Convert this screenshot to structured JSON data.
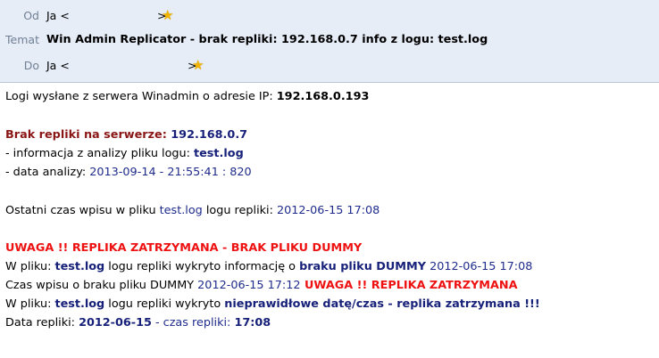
{
  "header": {
    "from_label": "Od",
    "from_value": "Ja <",
    "from_close": ">",
    "subject_label": "Temat",
    "subject_value": "Win Admin Replicator - brak repliki: 192.168.0.7 info z logu: test.log",
    "to_label": "Do",
    "to_value": "Ja <",
    "to_close": ">"
  },
  "message": {
    "l1_text": "Logi wysłane z serwera Winadmin o adresie IP: ",
    "l1_ip": "192.168.0.193",
    "l2_label": "Brak repliki na serwerze: ",
    "l2_ip": "192.168.0.7",
    "l3_text": "- informacja z analizy pliku logu: ",
    "l3_file": "test.log",
    "l4_text": "- data analizy: ",
    "l4_date": "2013-09-14 - 21:55:41 : 820",
    "l5_text1": "Ostatni czas wpisu w pliku ",
    "l5_file": "test.log",
    "l5_text2": " logu repliki: ",
    "l5_date": "2012-06-15 17:08",
    "l6_warning": "UWAGA !! REPLIKA ZATRZYMANA - BRAK PLIKU DUMMY",
    "l7_text1": "W pliku: ",
    "l7_file": "test.log",
    "l7_text2": " logu repliki wykryto informację o ",
    "l7_bold": "braku pliku DUMMY",
    "l7_date": " 2012-06-15 17:08",
    "l8_text1": "Czas wpisu o braku pliku DUMMY ",
    "l8_date": "2012-06-15 17:12",
    "l8_warning": " UWAGA !! REPLIKA ZATRZYMANA",
    "l9_text1": "W pliku: ",
    "l9_file": "test.log",
    "l9_text2": " logu repliki wykryto ",
    "l9_bold": "nieprawidłowe datę/czas - replika zatrzymana !!!",
    "l10_text1": "Data repliki: ",
    "l10_date": "2012-06-15",
    "l10_text2": " - czas repliki: ",
    "l10_time": "17:08"
  },
  "colors": {
    "header_bg": "#e7edf7",
    "navy": "#1f2c8c",
    "maroon": "#8a1515",
    "red": "#ee1111",
    "star": "#f0b400"
  },
  "icons": {
    "star": "star-icon"
  }
}
